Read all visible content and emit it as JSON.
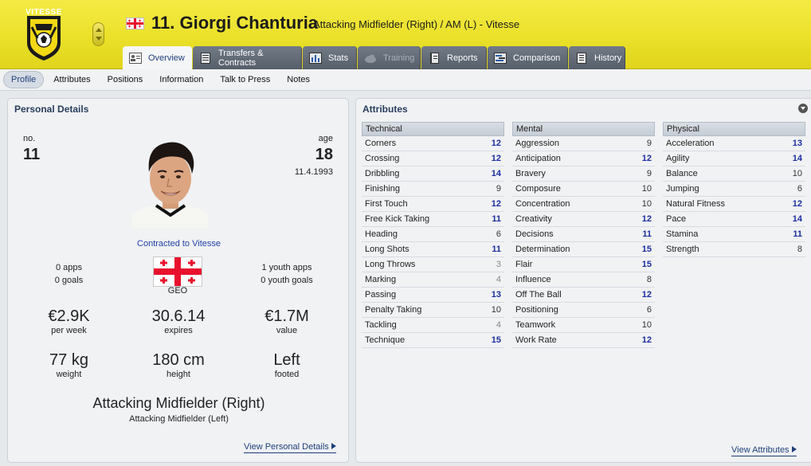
{
  "header": {
    "club_crest_text": "VITESSE",
    "player_title": "11. Giorgi Chanturia",
    "player_subtitle": "Attacking Midfielder (Right) / AM (L) - Vitesse",
    "accent_color": "#ebe12a"
  },
  "tabs": [
    {
      "label": "Overview",
      "icon": "profile-card-icon",
      "state": "active"
    },
    {
      "label": "Transfers & Contracts",
      "icon": "document-icon",
      "state": "normal"
    },
    {
      "label": "Stats",
      "icon": "bar-chart-icon",
      "state": "normal"
    },
    {
      "label": "Training",
      "icon": "cloud-icon",
      "state": "disabled"
    },
    {
      "label": "Reports",
      "icon": "notebook-icon",
      "state": "normal"
    },
    {
      "label": "Comparison",
      "icon": "comparison-icon",
      "state": "normal"
    },
    {
      "label": "History",
      "icon": "history-icon",
      "state": "normal"
    }
  ],
  "subnav": [
    "Profile",
    "Attributes",
    "Positions",
    "Information",
    "Talk to Press",
    "Notes"
  ],
  "personal": {
    "title": "Personal Details",
    "no_label": "no.",
    "no_value": "11",
    "age_label": "age",
    "age_value": "18",
    "dob": "11.4.1993",
    "contracted": "Contracted to Vitesse",
    "apps": "0 apps",
    "goals": "0 goals",
    "youth_apps": "1 youth apps",
    "youth_goals": "0 youth goals",
    "nation": "GEO",
    "wage_value": "€2.9K",
    "wage_label": "per week",
    "expires_value": "30.6.14",
    "expires_label": "expires",
    "value_value": "€1.7M",
    "value_label": "value",
    "weight_value": "77 kg",
    "weight_label": "weight",
    "height_value": "180 cm",
    "height_label": "height",
    "footed_value": "Left",
    "footed_label": "footed",
    "position_main": "Attacking Midfielder (Right)",
    "position_sub": "Attacking Midfielder (Left)",
    "link": "View Personal Details"
  },
  "attributes": {
    "title": "Attributes",
    "link": "View Attributes",
    "technical": {
      "label": "Technical",
      "rows": [
        {
          "name": "Corners",
          "value": "12"
        },
        {
          "name": "Crossing",
          "value": "12"
        },
        {
          "name": "Dribbling",
          "value": "14"
        },
        {
          "name": "Finishing",
          "value": "9"
        },
        {
          "name": "First Touch",
          "value": "12"
        },
        {
          "name": "Free Kick Taking",
          "value": "11"
        },
        {
          "name": "Heading",
          "value": "6"
        },
        {
          "name": "Long Shots",
          "value": "11"
        },
        {
          "name": "Long Throws",
          "value": "3"
        },
        {
          "name": "Marking",
          "value": "4"
        },
        {
          "name": "Passing",
          "value": "13"
        },
        {
          "name": "Penalty Taking",
          "value": "10"
        },
        {
          "name": "Tackling",
          "value": "4"
        },
        {
          "name": "Technique",
          "value": "15"
        }
      ]
    },
    "mental": {
      "label": "Mental",
      "rows": [
        {
          "name": "Aggression",
          "value": "9"
        },
        {
          "name": "Anticipation",
          "value": "12"
        },
        {
          "name": "Bravery",
          "value": "9"
        },
        {
          "name": "Composure",
          "value": "10"
        },
        {
          "name": "Concentration",
          "value": "10"
        },
        {
          "name": "Creativity",
          "value": "12"
        },
        {
          "name": "Decisions",
          "value": "11"
        },
        {
          "name": "Determination",
          "value": "15"
        },
        {
          "name": "Flair",
          "value": "15"
        },
        {
          "name": "Influence",
          "value": "8"
        },
        {
          "name": "Off The Ball",
          "value": "12"
        },
        {
          "name": "Positioning",
          "value": "6"
        },
        {
          "name": "Teamwork",
          "value": "10"
        },
        {
          "name": "Work Rate",
          "value": "12"
        }
      ]
    },
    "physical": {
      "label": "Physical",
      "rows": [
        {
          "name": "Acceleration",
          "value": "13"
        },
        {
          "name": "Agility",
          "value": "14"
        },
        {
          "name": "Balance",
          "value": "10"
        },
        {
          "name": "Jumping",
          "value": "6"
        },
        {
          "name": "Natural Fitness",
          "value": "12"
        },
        {
          "name": "Pace",
          "value": "14"
        },
        {
          "name": "Stamina",
          "value": "11"
        },
        {
          "name": "Strength",
          "value": "8"
        }
      ]
    }
  }
}
